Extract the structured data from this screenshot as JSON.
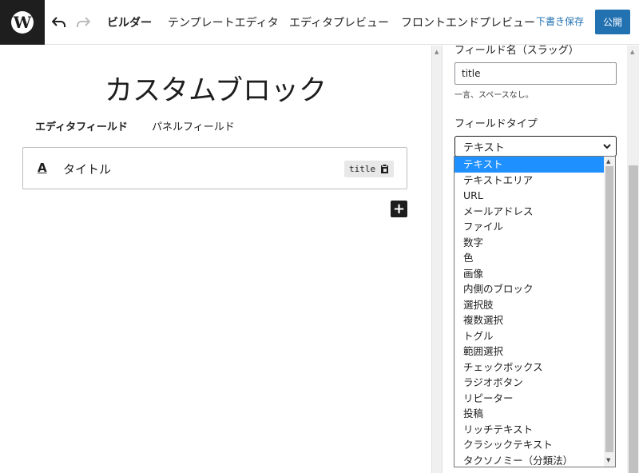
{
  "toolbar": {
    "logo_glyph": "W",
    "undo_icon": "undo-icon",
    "redo_icon": "redo-icon",
    "tabs": [
      "ビルダー",
      "テンプレートエディタ",
      "エディタプレビュー",
      "フロントエンドプレビュー"
    ],
    "draft_label": "下書き保存",
    "publish_label": "公開",
    "accent_color": "#2271b1"
  },
  "canvas": {
    "block_title": "カスタムブロック",
    "field_tabs": [
      "エディタフィールド",
      "パネルフィールド"
    ],
    "field": {
      "type_icon_glyph": "A",
      "label": "タイトル",
      "slug": "title"
    },
    "add_glyph": "+"
  },
  "sidebar": {
    "slug_label": "フィールド名（スラッグ）",
    "slug_value": "title",
    "slug_help": "一言、スペースなし。",
    "type_label": "フィールドタイプ",
    "type_selected": "テキスト",
    "type_options": [
      "テキスト",
      "テキストエリア",
      "URL",
      "メールアドレス",
      "ファイル",
      "数字",
      "色",
      "画像",
      "内側のブロック",
      "選択肢",
      "複数選択",
      "トグル",
      "範囲選択",
      "チェックボックス",
      "ラジオボタン",
      "リピーター",
      "投稿",
      "リッチテキスト",
      "クラシックテキスト",
      "タクソノミー（分類法）"
    ],
    "highlight_color": "#1e90ff"
  }
}
